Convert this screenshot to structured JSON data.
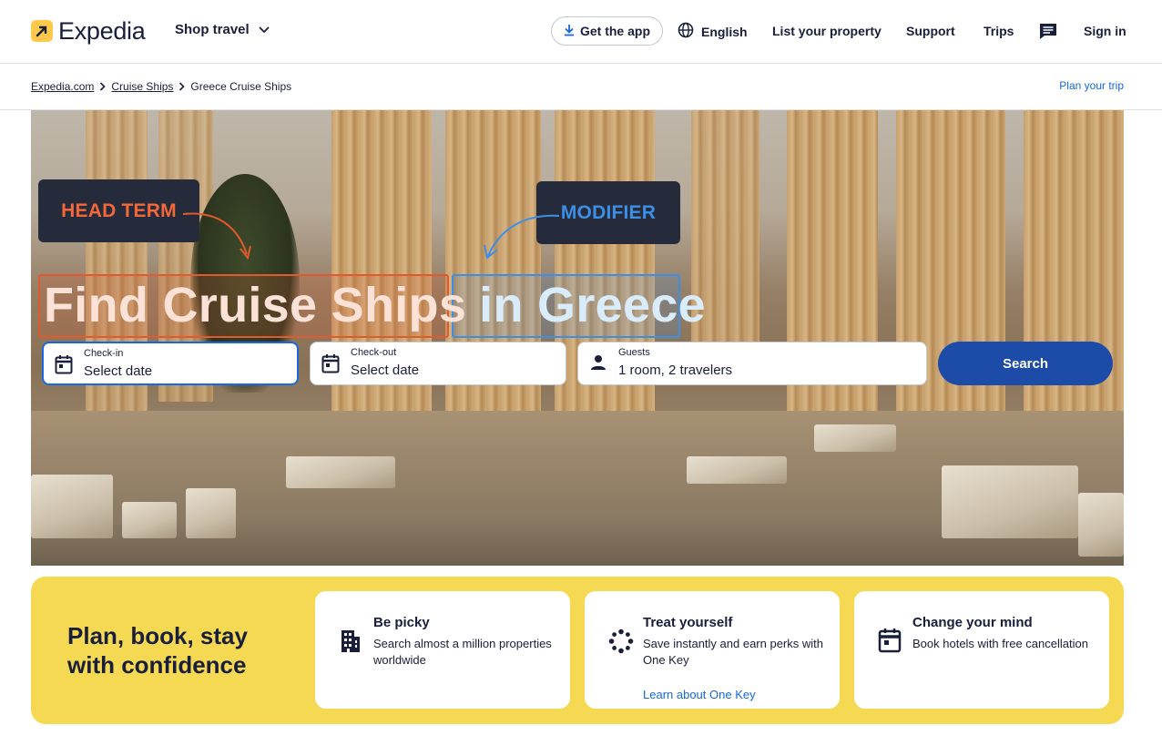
{
  "header": {
    "logo_text": "Expedia",
    "shop_travel": "Shop travel",
    "get_app": "Get the app",
    "language": "English",
    "list_property": "List your property",
    "support": "Support",
    "trips": "Trips",
    "sign_in": "Sign in",
    "icons": [
      "download-icon",
      "globe-icon",
      "chevron-down-icon",
      "message-icon"
    ]
  },
  "breadcrumb": {
    "items": [
      "Expedia.com",
      "Cruise Ships",
      "Greece Cruise Ships"
    ],
    "plan_trip": "Plan your trip"
  },
  "hero": {
    "annotation_head": "HEAD TERM",
    "annotation_modifier": "MODIFIER",
    "title_head": "Find Cruise Ships",
    "title_modifier": "in Greece",
    "checkin_label": "Check-in",
    "checkin_value": "Select date",
    "checkout_label": "Check-out",
    "checkout_value": "Select date",
    "guests_label": "Guests",
    "guests_value": "1 room, 2 travelers",
    "search_label": "Search"
  },
  "banner": {
    "title": "Plan, book, stay with confidence",
    "cards": [
      {
        "title": "Be picky",
        "desc": "Search almost a million properties worldwide",
        "icon": "building-icon"
      },
      {
        "title": "Treat yourself",
        "desc": "Save instantly and earn perks with One Key",
        "link": "Learn about One Key",
        "icon": "one-key-icon"
      },
      {
        "title": "Change your mind",
        "desc": "Book hotels with free cancellation",
        "icon": "calendar-icon"
      }
    ]
  },
  "colors": {
    "brand_navy": "#191e3b",
    "accent_yellow": "#f5d952",
    "button_blue": "#1d4ba8",
    "link_blue": "#1668e3",
    "head_term_orange": "#f2683a",
    "modifier_blue": "#3d8fe6"
  }
}
